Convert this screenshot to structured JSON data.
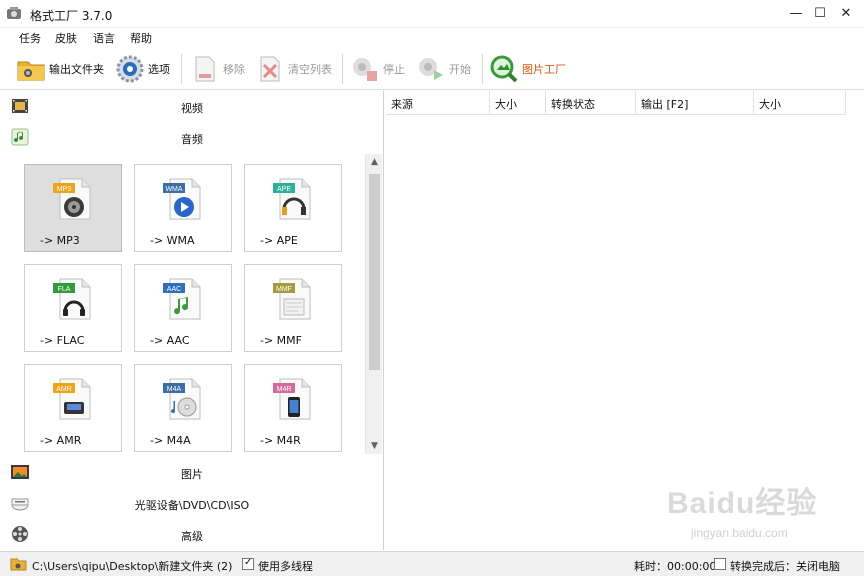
{
  "window": {
    "title": "格式工厂 3.7.0",
    "controls": {
      "minimize": "—",
      "maximize": "☐",
      "close": "✕"
    }
  },
  "menu": [
    "任务",
    "皮肤",
    "语言",
    "帮助"
  ],
  "toolbar": {
    "output_folder": "输出文件夹",
    "options": "选项",
    "remove": "移除",
    "clear_list": "清空列表",
    "stop": "停止",
    "start": "开始",
    "picture_factory": "图片工厂"
  },
  "categories": {
    "video": "视频",
    "audio": "音频",
    "picture": "图片",
    "disc": "光驱设备\\DVD\\CD\\ISO",
    "advanced": "高级"
  },
  "audio_formats": [
    {
      "label": "-> MP3",
      "badge": "MP3",
      "badge_color": "#f0a21a",
      "icon": "speaker-icon",
      "selected": true
    },
    {
      "label": "-> WMA",
      "badge": "WMA",
      "badge_color": "#3a6ea5",
      "icon": "play-icon",
      "selected": false
    },
    {
      "label": "-> APE",
      "badge": "APE",
      "badge_color": "#2eaf9c",
      "icon": "headphones-icon",
      "selected": false
    },
    {
      "label": "-> FLAC",
      "badge": "FLA",
      "badge_color": "#2f9a3e",
      "icon": "headset-icon",
      "selected": false
    },
    {
      "label": "-> AAC",
      "badge": "AAC",
      "badge_color": "#2f6fc0",
      "icon": "music-note-icon",
      "selected": false
    },
    {
      "label": "-> MMF",
      "badge": "MMF",
      "badge_color": "#a89a3c",
      "icon": "document-icon",
      "selected": false
    },
    {
      "label": "-> AMR",
      "badge": "AMR",
      "badge_color": "#f0a21a",
      "icon": "device-icon",
      "selected": false
    },
    {
      "label": "-> M4A",
      "badge": "M4A",
      "badge_color": "#3a6ea5",
      "icon": "cd-icon",
      "selected": false
    },
    {
      "label": "-> M4R",
      "badge": "M4R",
      "badge_color": "#d46a9a",
      "icon": "phone-icon",
      "selected": false
    }
  ],
  "task_list": {
    "columns": [
      "来源",
      "大小",
      "转换状态",
      "输出 [F2]",
      "大小"
    ]
  },
  "status": {
    "output_path": "C:\\Users\\qipu\\Desktop\\新建文件夹 (2)",
    "multithread_label": "使用多线程",
    "multithread_checked": true,
    "elapsed": "耗时：00:00:00",
    "shutdown_label": "转换完成后：关闭电脑",
    "shutdown_checked": false
  },
  "watermark": {
    "logo": "Baidu经验",
    "url": "jingyan.baidu.com"
  }
}
